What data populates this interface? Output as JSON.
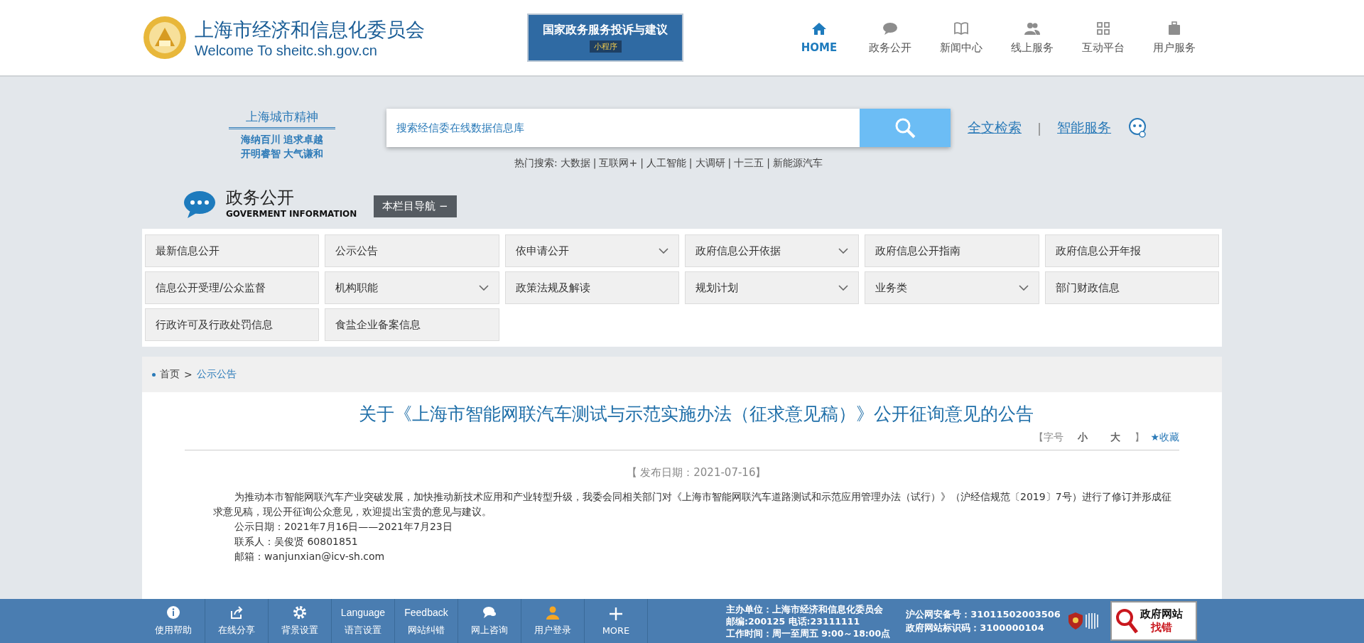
{
  "header": {
    "title": "上海市经济和信息化委员会",
    "subtitle": "Welcome To sheitc.sh.gov.cn",
    "banner": {
      "title": "国家政务服务投诉与建议",
      "tag": "小程序"
    },
    "nav": [
      {
        "label": "HOME",
        "kind": "home",
        "selected": true
      },
      {
        "label": "政务公开",
        "kind": "chat",
        "selected": false
      },
      {
        "label": "新闻中心",
        "kind": "book",
        "selected": false
      },
      {
        "label": "线上服务",
        "kind": "people",
        "selected": false
      },
      {
        "label": "互动平台",
        "kind": "grid",
        "selected": false
      },
      {
        "label": "用户服务",
        "kind": "case",
        "selected": false
      }
    ]
  },
  "slogan": {
    "title": "上海城市精神",
    "lines": [
      "海纳百川  追求卓越",
      "开明睿智  大气谦和"
    ]
  },
  "search": {
    "placeholder": "搜索经信委在线数据信息库",
    "links": [
      "全文检索",
      "智能服务"
    ],
    "separator": "|",
    "hot_label": "热门搜索:",
    "hot": [
      "大数据",
      "互联网+",
      "人工智能",
      "大调研",
      "十三五",
      "新能源汽车"
    ]
  },
  "section": {
    "title": "政务公开",
    "subtitle": "GOVERMENT INFORMATION",
    "nav_button": "本栏目导航 −"
  },
  "menu": [
    {
      "label": "最新信息公开",
      "kind": "link"
    },
    {
      "label": "公示公告",
      "kind": "link"
    },
    {
      "label": "依申请公开",
      "kind": "dropdown"
    },
    {
      "label": "政府信息公开依据",
      "kind": "dropdown"
    },
    {
      "label": "政府信息公开指南",
      "kind": "link"
    },
    {
      "label": "政府信息公开年报",
      "kind": "link"
    },
    {
      "label": "信息公开受理/公众监督",
      "kind": "link"
    },
    {
      "label": "机构职能",
      "kind": "dropdown"
    },
    {
      "label": "政策法规及解读",
      "kind": "link"
    },
    {
      "label": "规划计划",
      "kind": "dropdown"
    },
    {
      "label": "业务类",
      "kind": "dropdown"
    },
    {
      "label": "部门财政信息",
      "kind": "link"
    },
    {
      "label": "行政许可及行政处罚信息",
      "kind": "link"
    },
    {
      "label": "食盐企业备案信息",
      "kind": "link"
    }
  ],
  "breadcrumb": {
    "items": [
      "首页",
      "公示公告"
    ],
    "separator": ">"
  },
  "article": {
    "title": "关于《上海市智能网联汽车测试与示范实施办法（征求意见稿）》公开征询意见的公告",
    "tools": {
      "open": "【字号",
      "small": "小",
      "large": "大",
      "close": "】",
      "favorite": "★收藏"
    },
    "date": "【 发布日期：2021-07-16】",
    "paragraphs": [
      "为推动本市智能网联汽车产业突破发展，加快推动新技术应用和产业转型升级，我委会同相关部门对《上海市智能网联汽车道路测试和示范应用管理办法（试行）》（沪经信规范〔2019〕7号）进行了修订并形成征求意见稿，现公开征询公众意见，欢迎提出宝贵的意见与建议。",
      "公示日期：2021年7月16日——2021年7月23日",
      "联系人：吴俊贤  60801851",
      "邮箱：wanjunxian@icv-sh.com"
    ]
  },
  "footer": {
    "tools": [
      {
        "label": "使用帮助",
        "kind": "info"
      },
      {
        "label": "在线分享",
        "kind": "share"
      },
      {
        "label": "背景设置",
        "kind": "gear"
      },
      {
        "label": "语言设置",
        "kind": "text",
        "top": "Language"
      },
      {
        "label": "网站纠错",
        "kind": "text",
        "top": "Feedback"
      },
      {
        "label": "网上咨询",
        "kind": "chat"
      },
      {
        "label": "用户登录",
        "kind": "user"
      },
      {
        "label": "MORE",
        "kind": "plus"
      }
    ],
    "sponsor": [
      "主办单位：上海市经济和信息化委员会",
      "邮编:200125 电话:23111111",
      "工作时间：周一至周五 9:00～18:00点"
    ],
    "records": [
      "沪公网安备号：31011502003506",
      "政府网站标识码：3100000104"
    ],
    "badge": {
      "title": "政府网站",
      "action": "找错"
    }
  }
}
